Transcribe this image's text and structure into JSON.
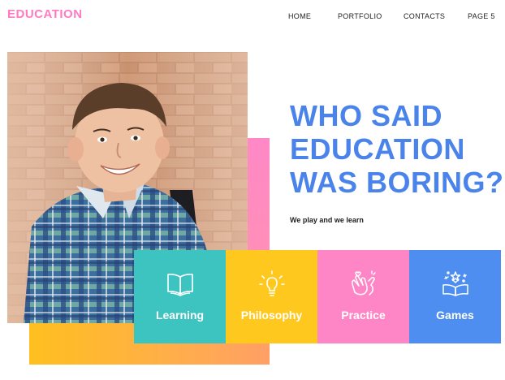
{
  "brand": {
    "logo": "EDUCATION"
  },
  "nav": [
    {
      "label": "HOME"
    },
    {
      "label": "PORTFOLIO"
    },
    {
      "label": "CONTACTS"
    },
    {
      "label": "PAGE 5"
    }
  ],
  "hero": {
    "headline_lines": [
      "WHO SAID",
      "EDUCATION",
      "WAS BORING?"
    ],
    "subtitle": "We play and we learn"
  },
  "tiles": [
    {
      "label": "Learning",
      "icon": "open-book-icon",
      "color": "#3ec4c0"
    },
    {
      "label": "Philosophy",
      "icon": "lightbulb-icon",
      "color": "#ffc81e"
    },
    {
      "label": "Practice",
      "icon": "clapping-hands-icon",
      "color": "#ff86c6"
    },
    {
      "label": "Games",
      "icon": "magic-book-icon",
      "color": "#4d8ef0"
    }
  ],
  "colors": {
    "brand_pink": "#ff7ac0",
    "headline_blue": "#4a84ea",
    "orange": "#ffbf1f"
  }
}
